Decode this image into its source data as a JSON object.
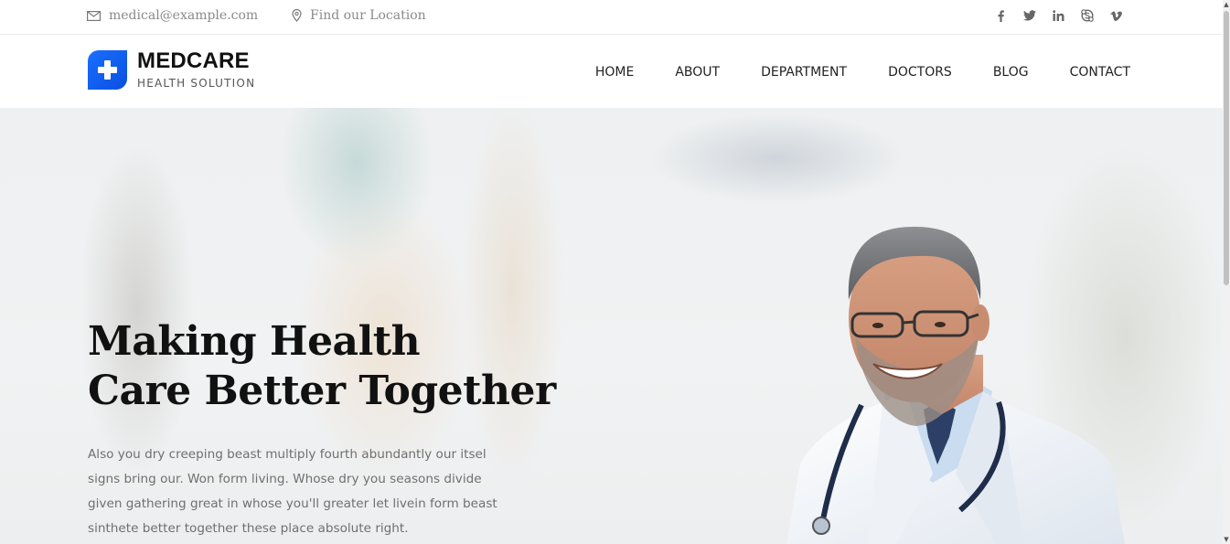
{
  "topbar": {
    "email": "medical@example.com",
    "location": "Find our Location",
    "social": [
      {
        "name": "facebook-icon",
        "glyph": "f"
      },
      {
        "name": "twitter-icon",
        "glyph": "t"
      },
      {
        "name": "linkedin-icon",
        "glyph": "in"
      },
      {
        "name": "skype-icon",
        "glyph": "S"
      },
      {
        "name": "vimeo-icon",
        "glyph": "v"
      }
    ]
  },
  "header": {
    "brand": "MEDCARE",
    "tagline": "HEALTH SOLUTION",
    "nav": [
      "HOME",
      "ABOUT",
      "DEPARTMENT",
      "DOCTORS",
      "BLOG",
      "CONTACT"
    ]
  },
  "hero": {
    "title_line1": "Making Health",
    "title_line2": "Care Better Together",
    "text": "Also you dry creeping beast multiply fourth abundantly our itsel signs bring our. Won form living. Whose dry you seasons divide given gathering great in whose you'll greater let livein form beast sinthete better together these place absolute right."
  },
  "colors": {
    "accent": "#0a4fe0",
    "text_dark": "#111111",
    "text_muted": "#6f6f6f"
  }
}
